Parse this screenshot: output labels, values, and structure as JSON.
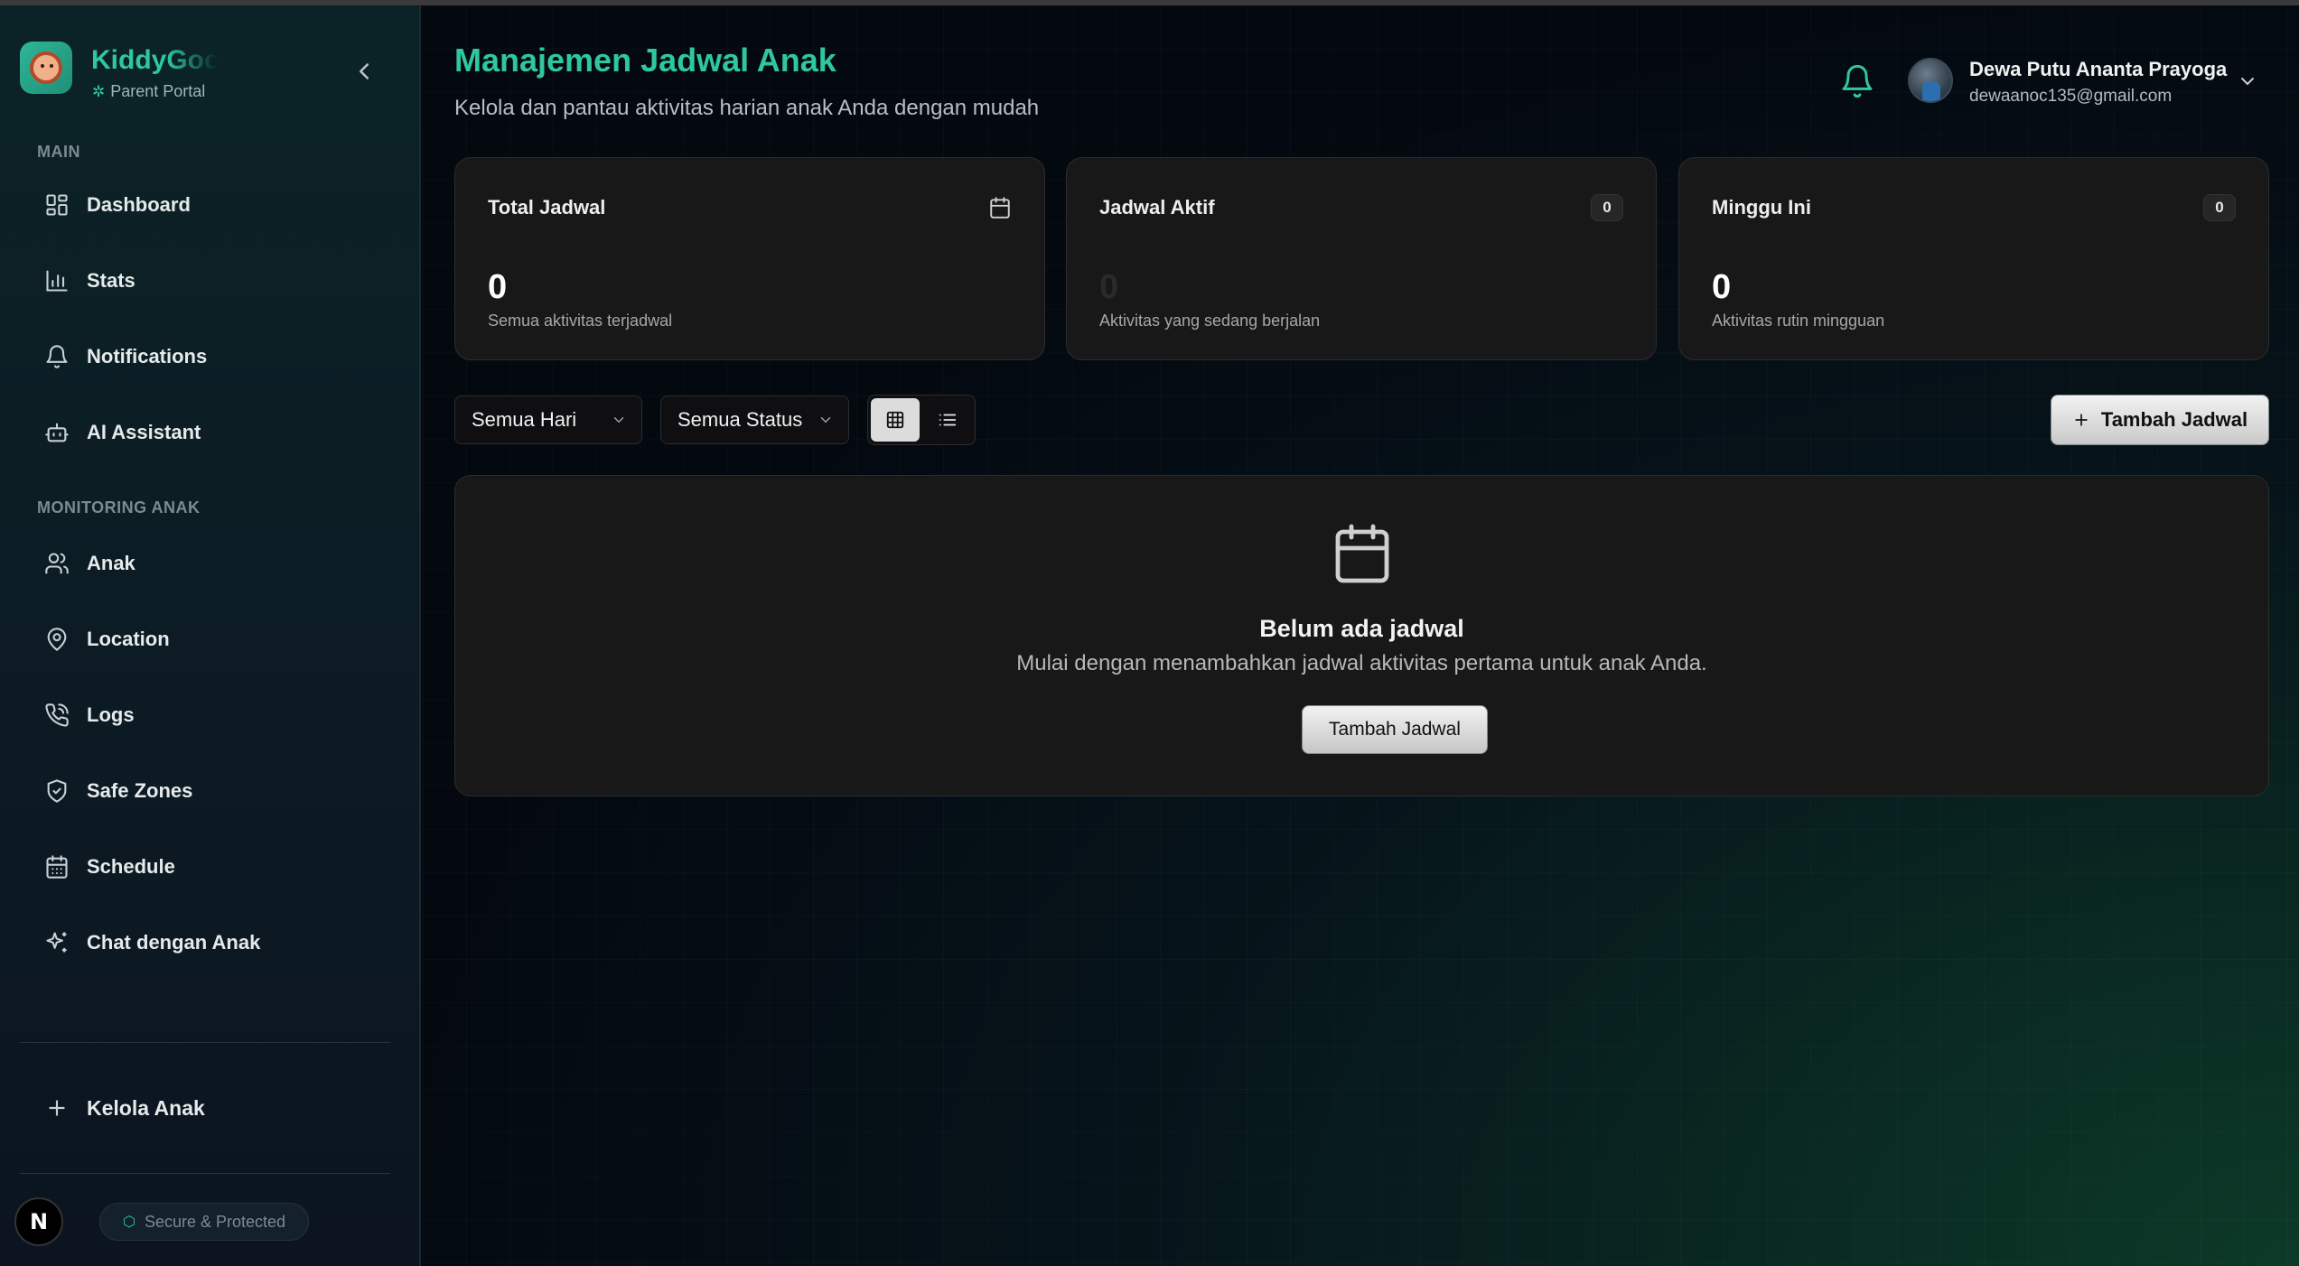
{
  "brand": {
    "name": "KiddyGoo",
    "subtitle": "Parent Portal"
  },
  "sidebar": {
    "section_main": "MAIN",
    "main_items": [
      {
        "label": "Dashboard",
        "icon": "dashboard-grid-icon"
      },
      {
        "label": "Stats",
        "icon": "bar-chart-icon"
      },
      {
        "label": "Notifications",
        "icon": "bell-icon"
      },
      {
        "label": "AI Assistant",
        "icon": "bot-icon"
      }
    ],
    "section_monitoring": "MONITORING ANAK",
    "monitoring_items": [
      {
        "label": "Anak",
        "icon": "users-icon"
      },
      {
        "label": "Location",
        "icon": "map-pin-icon"
      },
      {
        "label": "Logs",
        "icon": "phone-call-icon"
      },
      {
        "label": "Safe Zones",
        "icon": "shield-check-icon"
      },
      {
        "label": "Schedule",
        "icon": "calendar-icon"
      },
      {
        "label": "Chat dengan Anak",
        "icon": "sparkles-icon"
      }
    ],
    "kelola_label": "Kelola Anak",
    "footer_n": "N",
    "secure_label": "Secure & Protected"
  },
  "header": {
    "title": "Manajemen Jadwal Anak",
    "subtitle": "Kelola dan pantau aktivitas harian anak Anda dengan mudah",
    "user_name": "Dewa Putu Ananta Prayoga",
    "user_email": "dewaanoc135@gmail.com"
  },
  "stats": [
    {
      "title": "Total Jadwal",
      "value": "0",
      "desc": "Semua aktivitas terjadwal"
    },
    {
      "title": "Jadwal Aktif",
      "badge": "0",
      "value": "0",
      "desc": "Aktivitas yang sedang berjalan"
    },
    {
      "title": "Minggu Ini",
      "badge": "0",
      "value": "0",
      "desc": "Aktivitas rutin mingguan"
    }
  ],
  "filters": {
    "day_selected": "Semua Hari",
    "status_selected": "Semua Status",
    "add_label": "Tambah Jadwal"
  },
  "empty_state": {
    "title": "Belum ada jadwal",
    "desc": "Mulai dengan menambahkan jadwal aktivitas pertama untuk anak Anda.",
    "button": "Tambah Jadwal"
  },
  "colors": {
    "accent": "#2fc79e",
    "card_bg": "#181818",
    "sidebar_bg": "#0c1c24"
  }
}
